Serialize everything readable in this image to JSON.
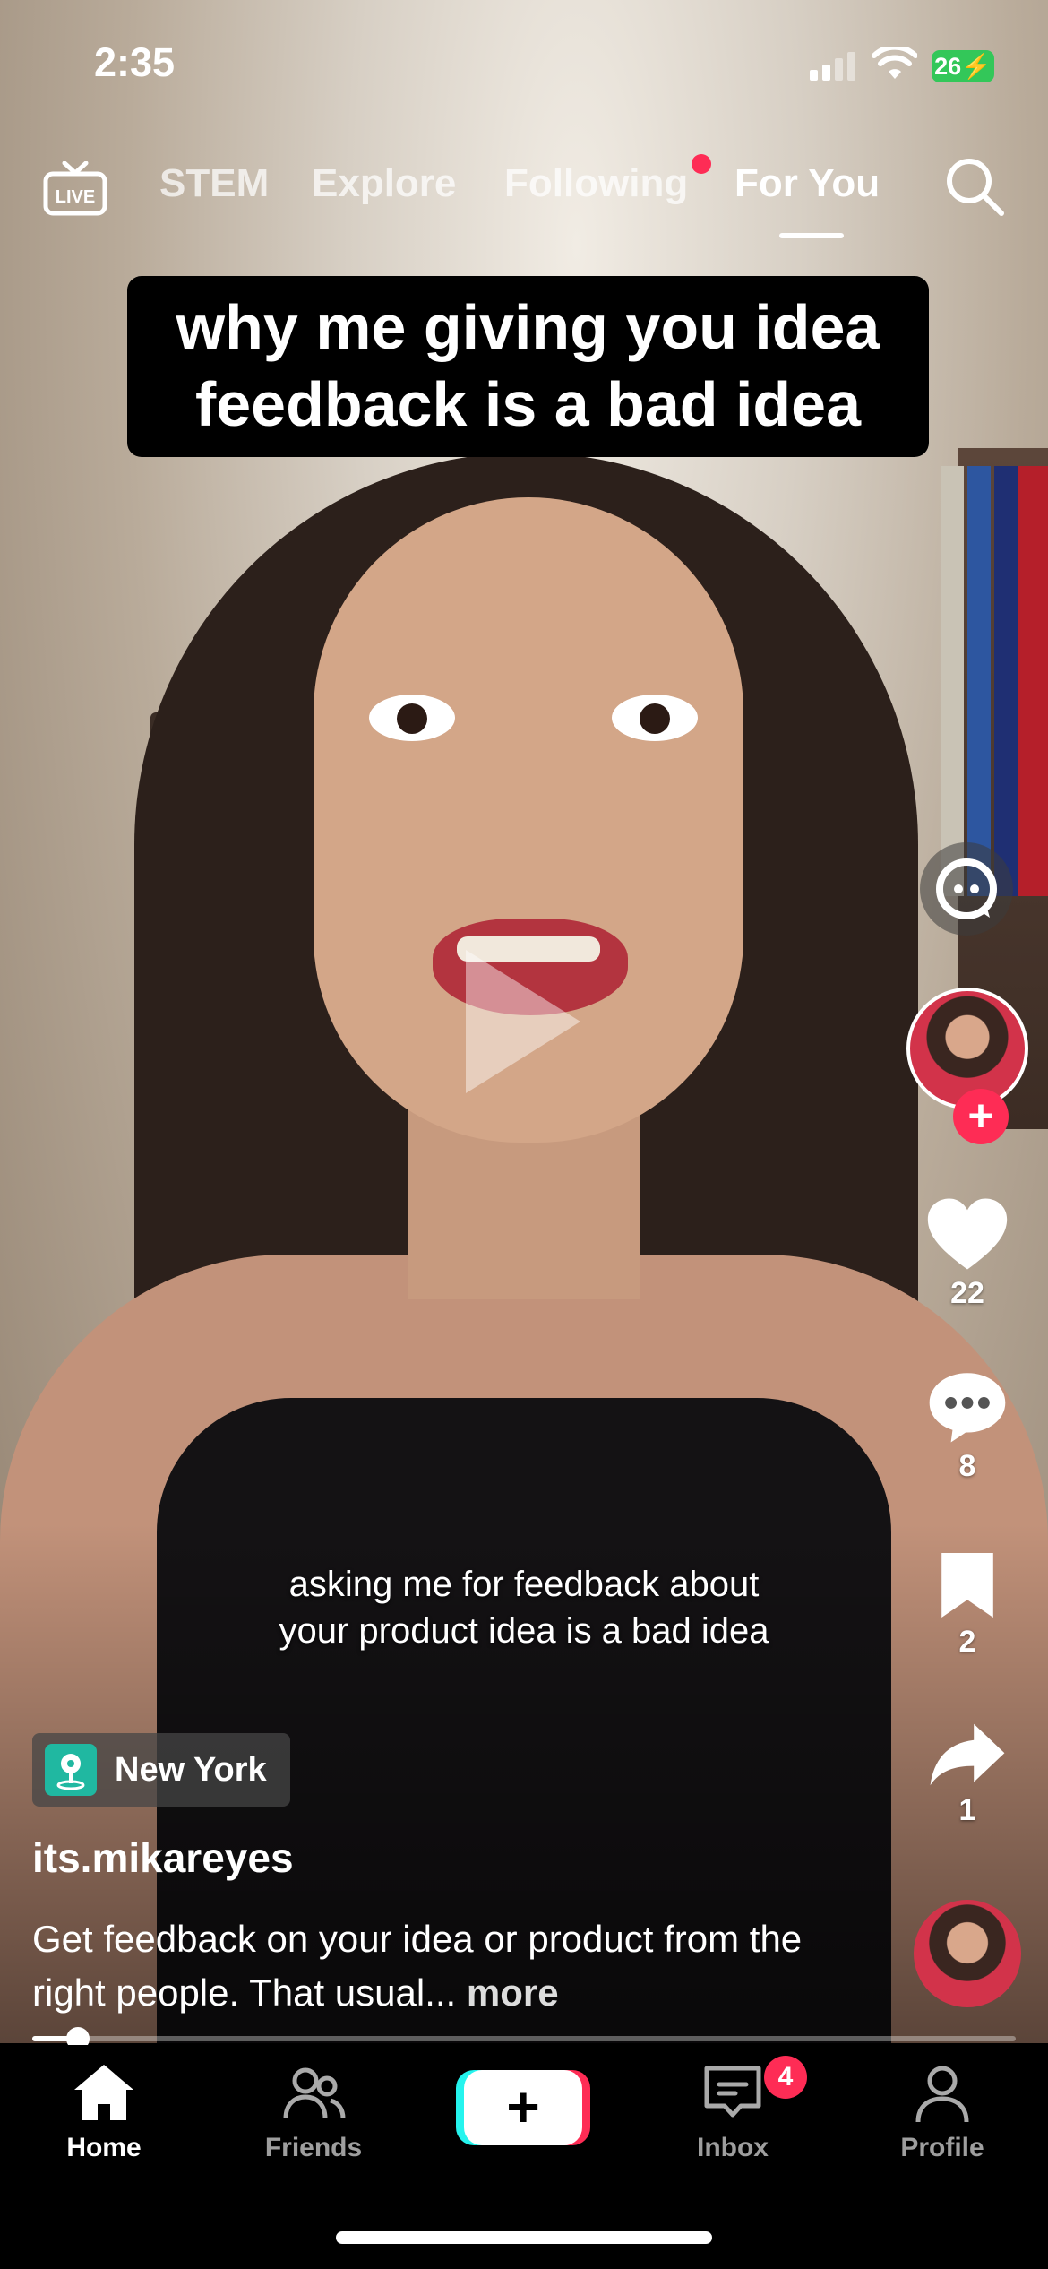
{
  "status_bar": {
    "time": "2:35",
    "battery": "26",
    "battery_color": "#33c759"
  },
  "top_nav": {
    "live_icon": "live-tv-icon",
    "tabs": [
      "STEM",
      "Explore",
      "Following",
      "For You"
    ],
    "active_tab": "For You",
    "search_icon": "search-icon"
  },
  "video": {
    "overlay_title": "why me giving you idea feedback is a bad idea",
    "caption": "asking me for feedback about your product idea is a bad idea",
    "play_icon": "play-icon",
    "progress": 0.046
  },
  "actions": {
    "likes": "22",
    "comments": "8",
    "saves": "2",
    "shares": "1",
    "icons": [
      "ai-chat-icon",
      "heart-icon",
      "comment-icon",
      "bookmark-icon",
      "share-icon"
    ]
  },
  "info": {
    "location": "New York",
    "username": "its.mikareyes",
    "description": "Get feedback on your idea or product from the right people. That usual...",
    "more_label": "more"
  },
  "tab_bar": {
    "home": "Home",
    "friends": "Friends",
    "inbox": "Inbox",
    "inbox_badge": "4",
    "profile": "Profile",
    "create_icon": "plus-icon"
  },
  "colors": {
    "accent_red": "#fe2c55",
    "accent_cyan": "#25f4ee"
  }
}
